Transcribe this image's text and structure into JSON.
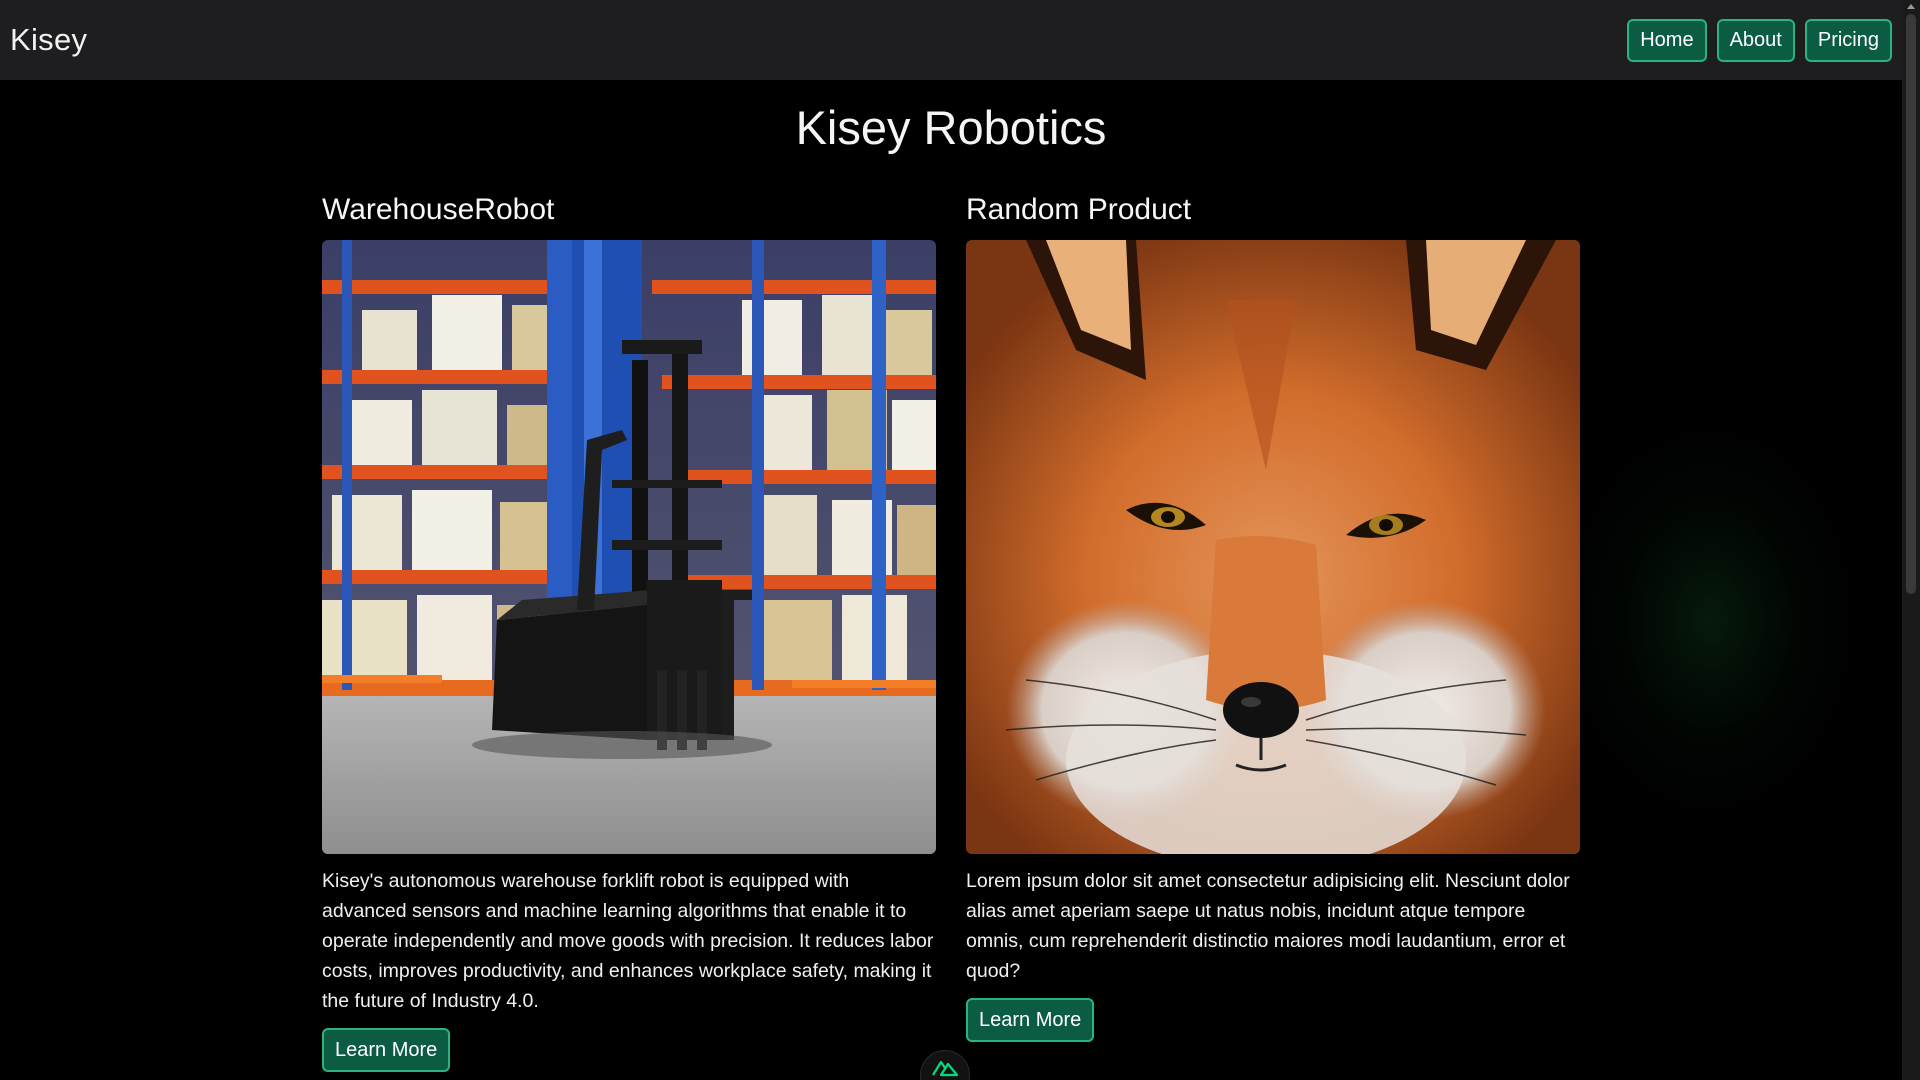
{
  "navbar": {
    "brand": "Kisey",
    "links": [
      "Home",
      "About",
      "Pricing"
    ]
  },
  "page": {
    "title": "Kisey Robotics"
  },
  "products": [
    {
      "title": "WarehouseRobot",
      "description": "Kisey's autonomous warehouse forklift robot is equipped with advanced sensors and machine learning algorithms that enable it to operate independently and move goods with precision. It reduces labor costs, improves productivity, and enhances workplace safety, making it the future of Industry 4.0.",
      "button": "Learn More",
      "image": "warehouse-forklift-robot-photo"
    },
    {
      "title": "Random Product",
      "description": "Lorem ipsum dolor sit amet consectetur adipisicing elit. Nesciunt dolor alias amet aperiam saepe ut natus nobis, incidunt atque tempore omnis, cum reprehenderit distinctio maiores modi laudantium, error et quod?",
      "button": "Learn More",
      "image": "red-fox-face-photo"
    }
  ],
  "colors": {
    "background": "#000000",
    "navbar": "#1e1e20",
    "button_fill": "#0c5c44",
    "button_border": "#29b37e",
    "nuxt_green": "#00dc82"
  },
  "icons": {
    "badge": "nuxt-logo-icon"
  }
}
